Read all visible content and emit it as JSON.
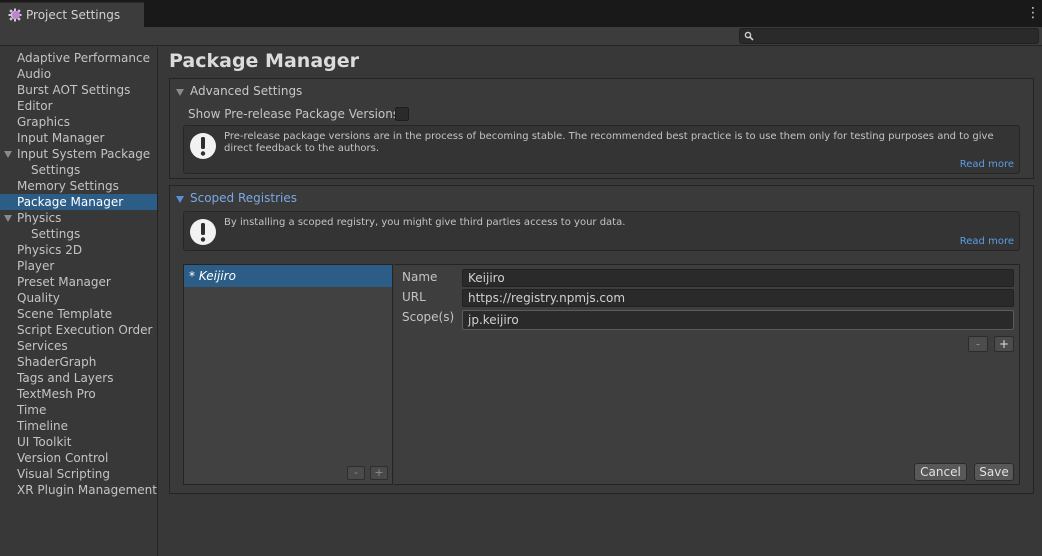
{
  "window": {
    "tab_title": "Project Settings"
  },
  "search": {
    "placeholder": "",
    "value": ""
  },
  "sidebar": {
    "items": [
      {
        "label": "Adaptive Performance",
        "level": 0
      },
      {
        "label": "Audio",
        "level": 0
      },
      {
        "label": "Burst AOT Settings",
        "level": 0
      },
      {
        "label": "Editor",
        "level": 0
      },
      {
        "label": "Graphics",
        "level": 0
      },
      {
        "label": "Input Manager",
        "level": 0
      },
      {
        "label": "Input System Package",
        "level": 0,
        "expanded": true
      },
      {
        "label": "Settings",
        "level": 1
      },
      {
        "label": "Memory Settings",
        "level": 0
      },
      {
        "label": "Package Manager",
        "level": 0,
        "selected": true
      },
      {
        "label": "Physics",
        "level": 0,
        "expanded": true
      },
      {
        "label": "Settings",
        "level": 1
      },
      {
        "label": "Physics 2D",
        "level": 0
      },
      {
        "label": "Player",
        "level": 0
      },
      {
        "label": "Preset Manager",
        "level": 0
      },
      {
        "label": "Quality",
        "level": 0
      },
      {
        "label": "Scene Template",
        "level": 0
      },
      {
        "label": "Script Execution Order",
        "level": 0
      },
      {
        "label": "Services",
        "level": 0
      },
      {
        "label": "ShaderGraph",
        "level": 0
      },
      {
        "label": "Tags and Layers",
        "level": 0
      },
      {
        "label": "TextMesh Pro",
        "level": 0
      },
      {
        "label": "Time",
        "level": 0
      },
      {
        "label": "Timeline",
        "level": 0
      },
      {
        "label": "UI Toolkit",
        "level": 0
      },
      {
        "label": "Version Control",
        "level": 0
      },
      {
        "label": "Visual Scripting",
        "level": 0
      },
      {
        "label": "XR Plugin Management",
        "level": 0
      }
    ]
  },
  "main": {
    "title": "Package Manager",
    "advanced": {
      "header": "Advanced Settings",
      "prerelease_label": "Show Pre-release Package Versions",
      "prerelease_checked": false,
      "help_text": "Pre-release package versions are in the process of becoming stable. The recommended best practice is to use them only for testing purposes and to give direct feedback to the authors.",
      "read_more": "Read more"
    },
    "scoped": {
      "header": "Scoped Registries",
      "help_text": "By installing a scoped registry, you might give third parties access to your data.",
      "read_more": "Read more",
      "registry_item": "* Keijiro",
      "list_minus": "-",
      "list_plus": "+",
      "form": {
        "name_label": "Name",
        "name_value": "Keijiro",
        "url_label": "URL",
        "url_value": "https://registry.npmjs.com",
        "scope_label": "Scope(s)",
        "scope_value": "jp.keijiro",
        "scope_minus": "-",
        "scope_plus": "+",
        "cancel": "Cancel",
        "save": "Save"
      }
    }
  },
  "colors": {
    "selection": "#2c5d87",
    "link": "#5c9ce8",
    "background": "#383838"
  }
}
